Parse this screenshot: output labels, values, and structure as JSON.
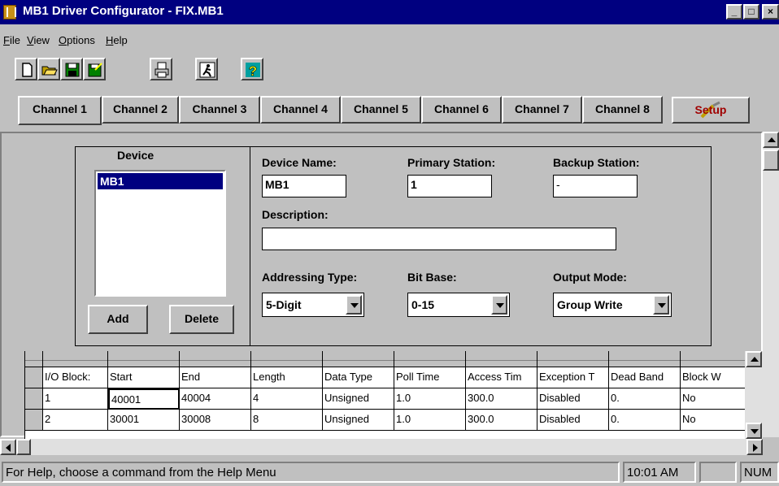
{
  "window": {
    "title": "MB1 Driver Configurator - FIX.MB1",
    "controls": {
      "minimize": "_",
      "maximize": "□",
      "close": "×"
    }
  },
  "menu": [
    {
      "label": "File",
      "mnemonic": "F"
    },
    {
      "label": "View",
      "mnemonic": "V"
    },
    {
      "label": "Options",
      "mnemonic": "O"
    },
    {
      "label": "Help",
      "mnemonic": "H"
    }
  ],
  "toolbar": {
    "icons": [
      "new-file-icon",
      "open-folder-icon",
      "save-disk-icon",
      "save-as-icon",
      "print-icon",
      "exit-running-man-icon",
      "help-question-icon"
    ],
    "colors": {
      "help_bg": "#00a0a0",
      "help_fg": "#ffff00",
      "save_bg": "#008000"
    }
  },
  "channels": {
    "tabs": [
      "Channel 1",
      "Channel 2",
      "Channel 3",
      "Channel 4",
      "Channel 5",
      "Channel 6",
      "Channel 7",
      "Channel 8"
    ],
    "active": "Channel 1",
    "setup_label": "Setup"
  },
  "device": {
    "caption": "Device",
    "items": [
      "MB1"
    ],
    "add_label": "Add",
    "delete_label": "Delete"
  },
  "properties": {
    "device_name_label": "Device Name:",
    "device_name_value": "MB1",
    "primary_station_label": "Primary Station:",
    "primary_station_value": "1",
    "backup_station_label": "Backup Station:",
    "backup_station_value": "-",
    "description_label": "Description:",
    "description_value": "",
    "addressing_type_label": "Addressing Type:",
    "addressing_type_value": "5-Digit",
    "bit_base_label": "Bit Base:",
    "bit_base_value": "0-15",
    "output_mode_label": "Output Mode:",
    "output_mode_value": "Group Write"
  },
  "grid": {
    "columns": [
      "I/O Block:",
      "Start",
      "End",
      "Length",
      "Data Type",
      "Poll Time",
      "Access Tim",
      "Exception T",
      "Dead Band",
      "Block W"
    ],
    "rows": [
      [
        "1",
        "40001",
        "40004",
        "4",
        "Unsigned",
        "1.0",
        "300.0",
        "Disabled",
        "0.",
        "No"
      ],
      [
        "2",
        "30001",
        "30008",
        "8",
        "Unsigned",
        "1.0",
        "300.0",
        "Disabled",
        "0.",
        "No"
      ]
    ]
  },
  "status": {
    "message": "For Help, choose a command from the Help Menu",
    "time": "10:01 AM",
    "blank": "",
    "num": "NUM"
  }
}
